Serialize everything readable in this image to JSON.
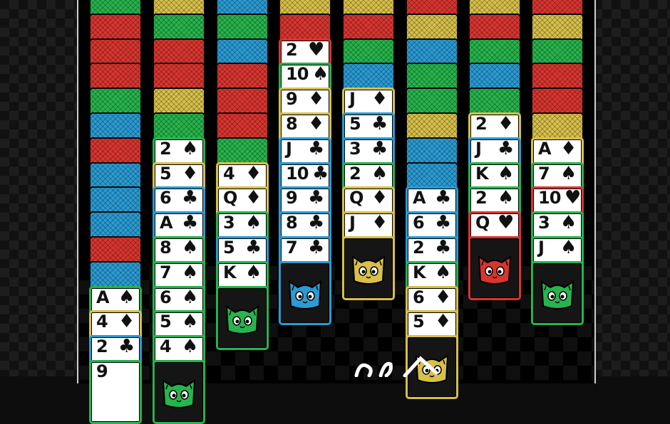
{
  "colors": {
    "red": "#d9352f",
    "green": "#27b44c",
    "blue": "#2a9bd3",
    "yellow": "#d8c04a",
    "board": "#000000",
    "frame": "#cfcfcf"
  },
  "columns": [
    {
      "id": "col1",
      "backs": [
        "green",
        "red",
        "red",
        "red",
        "green",
        "blue",
        "red",
        "blue",
        "blue",
        "blue",
        "red",
        "blue"
      ],
      "faces": [
        {
          "rank": "A",
          "suit": "♠",
          "border": "green"
        },
        {
          "rank": "4",
          "suit": "♦",
          "border": "yellow"
        },
        {
          "rank": "2",
          "suit": "♣",
          "border": "blue"
        },
        {
          "rank": "9",
          "suit": "",
          "border": "green"
        }
      ],
      "cat": null
    },
    {
      "id": "col2",
      "backs": [
        "yellow",
        "green",
        "red",
        "red",
        "yellow",
        "green"
      ],
      "faces": [
        {
          "rank": "2",
          "suit": "♠",
          "border": "green"
        },
        {
          "rank": "5",
          "suit": "♦",
          "border": "yellow"
        },
        {
          "rank": "6",
          "suit": "♣",
          "border": "blue"
        },
        {
          "rank": "A",
          "suit": "♣",
          "border": "blue"
        },
        {
          "rank": "8",
          "suit": "♠",
          "border": "green"
        },
        {
          "rank": "7",
          "suit": "♠",
          "border": "green"
        },
        {
          "rank": "6",
          "suit": "♠",
          "border": "green"
        },
        {
          "rank": "5",
          "suit": "♠",
          "border": "green"
        },
        {
          "rank": "4",
          "suit": "♠",
          "border": "green"
        }
      ],
      "cat": {
        "color": "green",
        "partial": true
      }
    },
    {
      "id": "col3",
      "backs": [
        "blue",
        "green",
        "blue",
        "red",
        "red",
        "red",
        "green"
      ],
      "faces": [
        {
          "rank": "4",
          "suit": "♦",
          "border": "yellow"
        },
        {
          "rank": "Q",
          "suit": "♦",
          "border": "yellow"
        },
        {
          "rank": "3",
          "suit": "♠",
          "border": "green"
        },
        {
          "rank": "5",
          "suit": "♣",
          "border": "blue"
        },
        {
          "rank": "K",
          "suit": "♠",
          "border": "green"
        }
      ],
      "cat": {
        "color": "green",
        "partial": false
      }
    },
    {
      "id": "col4",
      "backs": [
        "yellow",
        "red"
      ],
      "faces": [
        {
          "rank": "2",
          "suit": "♥",
          "border": "red"
        },
        {
          "rank": "10",
          "suit": "♠",
          "border": "green"
        },
        {
          "rank": "9",
          "suit": "♦",
          "border": "yellow"
        },
        {
          "rank": "8",
          "suit": "♦",
          "border": "yellow"
        },
        {
          "rank": "J",
          "suit": "♣",
          "border": "blue"
        },
        {
          "rank": "10",
          "suit": "♣",
          "border": "blue"
        },
        {
          "rank": "9",
          "suit": "♣",
          "border": "blue"
        },
        {
          "rank": "8",
          "suit": "♣",
          "border": "blue"
        },
        {
          "rank": "7",
          "suit": "♣",
          "border": "blue"
        }
      ],
      "cat": {
        "color": "blue",
        "partial": false
      }
    },
    {
      "id": "col5",
      "backs": [
        "yellow",
        "red",
        "green",
        "blue"
      ],
      "faces": [
        {
          "rank": "J",
          "suit": "♦",
          "border": "yellow"
        },
        {
          "rank": "5",
          "suit": "♣",
          "border": "blue"
        },
        {
          "rank": "3",
          "suit": "♣",
          "border": "blue"
        },
        {
          "rank": "2",
          "suit": "♠",
          "border": "green"
        },
        {
          "rank": "Q",
          "suit": "♦",
          "border": "yellow"
        },
        {
          "rank": "J",
          "suit": "♦",
          "border": "yellow"
        }
      ],
      "cat": {
        "color": "yellow",
        "partial": false
      }
    },
    {
      "id": "col6",
      "backs": [
        "red",
        "yellow",
        "blue",
        "green",
        "green",
        "yellow",
        "blue",
        "blue"
      ],
      "faces": [
        {
          "rank": "A",
          "suit": "♣",
          "border": "blue"
        },
        {
          "rank": "6",
          "suit": "♣",
          "border": "blue"
        },
        {
          "rank": "2",
          "suit": "♣",
          "border": "blue"
        },
        {
          "rank": "K",
          "suit": "♠",
          "border": "green"
        },
        {
          "rank": "6",
          "suit": "♦",
          "border": "yellow"
        },
        {
          "rank": "5",
          "suit": "♦",
          "border": "yellow"
        }
      ],
      "cat": {
        "color": "yellow",
        "partial": true
      }
    },
    {
      "id": "col7",
      "backs": [
        "yellow",
        "red",
        "green",
        "blue",
        "green"
      ],
      "faces": [
        {
          "rank": "2",
          "suit": "♦",
          "border": "yellow"
        },
        {
          "rank": "J",
          "suit": "♣",
          "border": "blue"
        },
        {
          "rank": "K",
          "suit": "♠",
          "border": "green"
        },
        {
          "rank": "2",
          "suit": "♠",
          "border": "green"
        },
        {
          "rank": "Q",
          "suit": "♥",
          "border": "red"
        }
      ],
      "cat": {
        "color": "red",
        "partial": false
      }
    },
    {
      "id": "col8",
      "backs": [
        "red",
        "yellow",
        "green",
        "red",
        "red",
        "yellow"
      ],
      "faces": [
        {
          "rank": "A",
          "suit": "♦",
          "border": "yellow"
        },
        {
          "rank": "7",
          "suit": "♠",
          "border": "green"
        },
        {
          "rank": "10",
          "suit": "♥",
          "border": "red"
        },
        {
          "rank": "3",
          "suit": "♠",
          "border": "green"
        },
        {
          "rank": "J",
          "suit": "♠",
          "border": "green"
        }
      ],
      "cat": {
        "color": "green",
        "partial": false
      }
    }
  ]
}
